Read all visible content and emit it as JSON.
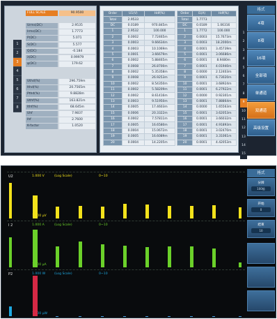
{
  "top_panel": {
    "left_nav_tabs": [
      "1",
      "2",
      "3",
      "4",
      "5",
      "6",
      "7",
      "8"
    ],
    "active_nav_tab": 2,
    "kv_groups": [
      [
        {
          "label": "FULL SCALE",
          "value": "90.9500",
          "highlight": true
        }
      ],
      [
        {
          "label": "Urms(DC)",
          "value": "2.9535"
        },
        {
          "label": "Irms(DC)",
          "value": "1.7773"
        },
        {
          "label": "P(DC)",
          "value": "5.071"
        },
        {
          "label": "S(DC)",
          "value": "5.577"
        },
        {
          "label": "Q(DC)",
          "value": "-0.184"
        },
        {
          "label": "λ(DC)",
          "value": "0.99979"
        },
        {
          "label": "φ(DC)",
          "value": "179.62"
        }
      ],
      [
        {
          "label": "Uthd(%)",
          "value": "296.759m"
        },
        {
          "label": "Ithd(%)",
          "value": "20.7565m"
        },
        {
          "label": "Pthd(%)",
          "value": "9.8828m"
        },
        {
          "label": "Uthf(%)",
          "value": "163.821m"
        },
        {
          "label": "Ithf(%)",
          "value": "68.645m"
        },
        {
          "label": "Uhf",
          "value": "7.9837"
        },
        {
          "label": "Ihf",
          "value": "2.7600"
        },
        {
          "label": "K-factor",
          "value": "1.0520"
        }
      ]
    ],
    "table": {
      "left_headers": [
        "Order",
        "U1(V)",
        "Hdf(%)"
      ],
      "right_headers": [
        "Order",
        "I1(A)",
        "Hdf(%)"
      ],
      "rows": [
        {
          "order": "Total",
          "u": "2.9533",
          "uh": "",
          "iord": "Total",
          "i": "1.7773",
          "ih": ""
        },
        {
          "order": "DC",
          "u": "0.0189",
          "uh": "970.845m",
          "iord": "DC",
          "i": "0.0189",
          "ih": "1.06316"
        },
        {
          "order": "1",
          "u": "2.9532",
          "uh": "100.000",
          "iord": "1",
          "i": "1.7772",
          "ih": "100.000"
        },
        {
          "order": "2",
          "u": "0.0002",
          "uh": "7.72465m",
          "iord": "2",
          "i": "0.0003",
          "ih": "15.7673m"
        },
        {
          "order": "3",
          "u": "0.0003",
          "uh": "9.66634m",
          "iord": "3",
          "i": "0.0003",
          "ih": "18.2000m"
        },
        {
          "order": "4",
          "u": "0.0003",
          "uh": "10.1069m",
          "iord": "4",
          "i": "0.0001",
          "ih": "3.45739m"
        },
        {
          "order": "5",
          "u": "0.0001",
          "uh": "3.66679m",
          "iord": "5",
          "i": "0.0001",
          "ih": "3.06686m"
        },
        {
          "order": "6",
          "u": "0.0002",
          "uh": "5.88465m",
          "iord": "6",
          "i": "0.0001",
          "ih": "8.9480m"
        },
        {
          "order": "7",
          "u": "0.0008",
          "uh": "26.8700m",
          "iord": "7",
          "i": "0.0001",
          "ih": "4.01940m"
        },
        {
          "order": "8",
          "u": "0.0002",
          "uh": "5.35358m",
          "iord": "8",
          "i": "0.0000",
          "ih": "2.12403m"
        },
        {
          "order": "9",
          "u": "0.0008",
          "uh": "26.9253m",
          "iord": "9",
          "i": "0.0001",
          "ih": "6.73020m"
        },
        {
          "order": "10",
          "u": "0.0002",
          "uh": "8.54350m",
          "iord": "10",
          "i": "0.0001",
          "ih": "3.68924m"
        },
        {
          "order": "11",
          "u": "0.0002",
          "uh": "5.58209m",
          "iord": "11",
          "i": "0.0001",
          "ih": "6.27922m"
        },
        {
          "order": "12",
          "u": "0.0002",
          "uh": "8.61416m",
          "iord": "12",
          "i": "0.0000",
          "ih": "0.92301m"
        },
        {
          "order": "13",
          "u": "0.0003",
          "uh": "9.51950m",
          "iord": "13",
          "i": "0.0001",
          "ih": "7.88864m"
        },
        {
          "order": "14",
          "u": "0.0005",
          "uh": "17.4603m",
          "iord": "14",
          "i": "0.0000",
          "ih": "1.65563m"
        },
        {
          "order": "15",
          "u": "0.0006",
          "uh": "20.3322m",
          "iord": "15",
          "i": "0.0001",
          "ih": "3.62053m"
        },
        {
          "order": "16",
          "u": "0.0002",
          "uh": "7.57811m",
          "iord": "16",
          "i": "0.0001",
          "ih": "3.66032m"
        },
        {
          "order": "17",
          "u": "0.0005",
          "uh": "16.6580m",
          "iord": "17",
          "i": "0.0001",
          "ih": "4.91893m"
        },
        {
          "order": "18",
          "u": "0.0004",
          "uh": "15.0672m",
          "iord": "18",
          "i": "0.0001",
          "ih": "3.02470m"
        },
        {
          "order": "19",
          "u": "0.0005",
          "uh": "16.6089m",
          "iord": "19",
          "i": "0.0001",
          "ih": "3.31061m"
        },
        {
          "order": "20",
          "u": "0.0004",
          "uh": "14.2205m",
          "iord": "20",
          "i": "0.0001",
          "ih": "4.42053m"
        }
      ]
    },
    "scroll_numbers": [
      "1",
      "2",
      "3",
      "4",
      "5",
      "6",
      "7",
      "8",
      "9",
      "10",
      "11",
      "12",
      "13",
      "14",
      "15"
    ],
    "active_scroll_number": 8,
    "menu": {
      "title": "格式",
      "buttons": [
        "4項",
        "8項",
        "16項",
        "全部項",
        "单通道",
        "双通道",
        "高级设置"
      ],
      "active": 5
    }
  },
  "bottom_panel": {
    "plots": [
      {
        "name": "U2",
        "top": "1.000 V",
        "scale": "(Log Scale)",
        "range": "0~10",
        "bottom": "1.000 μV",
        "color": "#f3e21b",
        "bars": [
          0.85,
          0.55,
          0.28,
          0.3,
          0.28,
          0.35,
          0.33,
          0.3,
          0.3,
          0.32,
          0.27
        ]
      },
      {
        "name": "I 2",
        "top": "1.000 A",
        "scale": "(Log Scale)",
        "range": "0~10",
        "bottom": "1.000 μA",
        "color": "#6bd12a",
        "bars": [
          0.72,
          0.9,
          0.5,
          0.62,
          0.55,
          0.52,
          0.48,
          0.5,
          0.5,
          0.45,
          0.12
        ]
      },
      {
        "name": "P2",
        "top": "1.000 W",
        "scale": "(Log Scale)",
        "range": "0~10",
        "bottom": "1.000 μW",
        "color": "#1ea8e0",
        "bars": [
          0.24,
          0.97,
          0,
          0,
          0,
          0,
          0,
          0,
          0,
          0,
          0
        ]
      }
    ],
    "menu": {
      "title": "格式",
      "items": [
        {
          "label": "分辨",
          "value": "100倍"
        },
        {
          "label": "开始",
          "value": "0"
        },
        {
          "label": "结束",
          "value": "10"
        }
      ]
    }
  }
}
